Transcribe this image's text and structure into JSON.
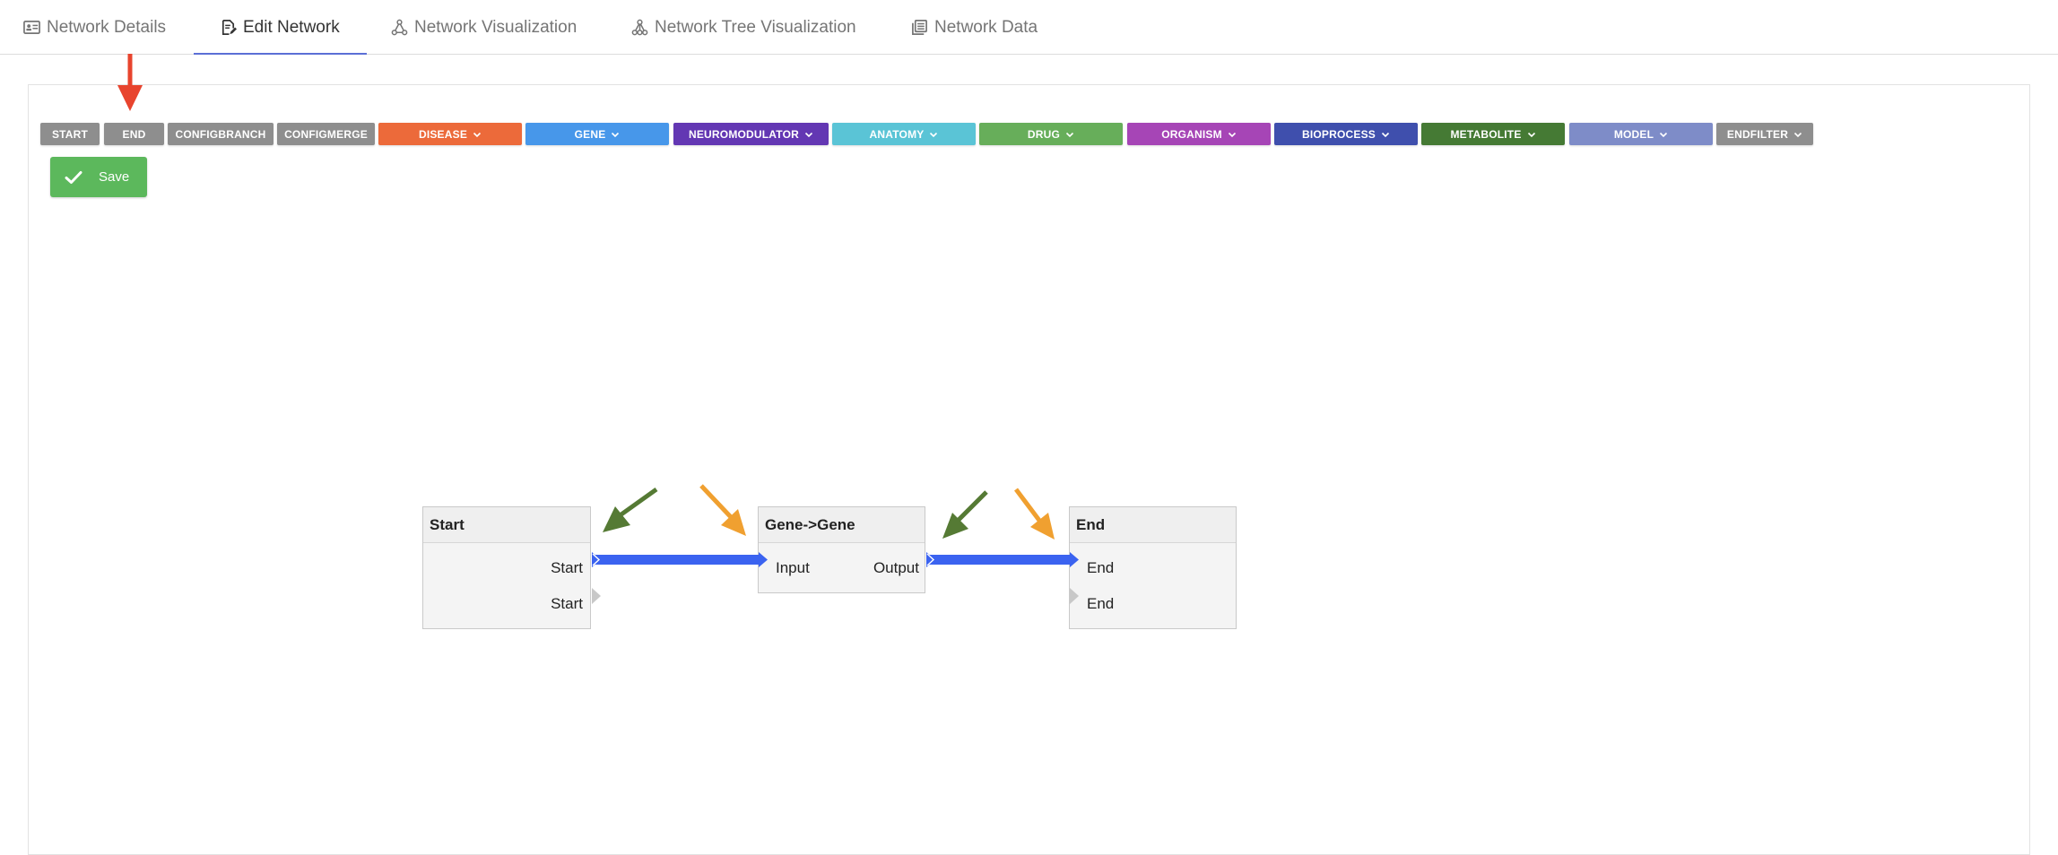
{
  "tabs": [
    {
      "label": "Network Details",
      "icon": "id-card-icon",
      "active": false
    },
    {
      "label": "Edit Network",
      "icon": "edit-document-icon",
      "active": true
    },
    {
      "label": "Network Visualization",
      "icon": "network-graph-icon",
      "active": false
    },
    {
      "label": "Network Tree Visualization",
      "icon": "tree-graph-icon",
      "active": false
    },
    {
      "label": "Network Data",
      "icon": "data-table-icon",
      "active": false
    }
  ],
  "toolbar": {
    "chips": [
      {
        "label": "START",
        "color": "#8e8e8e",
        "dropdown": false
      },
      {
        "label": "END",
        "color": "#8e8e8e",
        "dropdown": false
      },
      {
        "label": "CONFIGBRANCH",
        "color": "#8e8e8e",
        "dropdown": false
      },
      {
        "label": "CONFIGMERGE",
        "color": "#8e8e8e",
        "dropdown": false
      },
      {
        "label": "DISEASE",
        "color": "#ec6a3a",
        "dropdown": true
      },
      {
        "label": "GENE",
        "color": "#4797ea",
        "dropdown": true
      },
      {
        "label": "NEUROMODULATOR",
        "color": "#6337b3",
        "dropdown": true
      },
      {
        "label": "ANATOMY",
        "color": "#5ac4d6",
        "dropdown": true
      },
      {
        "label": "DRUG",
        "color": "#67ae5a",
        "dropdown": true
      },
      {
        "label": "ORGANISM",
        "color": "#a645b6",
        "dropdown": true
      },
      {
        "label": "BIOPROCESS",
        "color": "#3f4fad",
        "dropdown": true
      },
      {
        "label": "METABOLITE",
        "color": "#457a34",
        "dropdown": true
      },
      {
        "label": "MODEL",
        "color": "#7e8cc8",
        "dropdown": true
      },
      {
        "label": "ENDFILTER",
        "color": "#8e8e8e",
        "dropdown": true
      }
    ],
    "save_label": "Save"
  },
  "nodes": {
    "start": {
      "title": "Start",
      "ports": [
        "Start",
        "Start"
      ]
    },
    "gene": {
      "title": "Gene->Gene",
      "input": "Input",
      "output": "Output"
    },
    "end": {
      "title": "End",
      "ports": [
        "End",
        "End"
      ]
    }
  },
  "colors": {
    "link": "#3b63f0",
    "port": "#c8c8c8",
    "arrow_red": "#e8442e",
    "arrow_green": "#557a34",
    "arrow_orange": "#f0a030"
  }
}
